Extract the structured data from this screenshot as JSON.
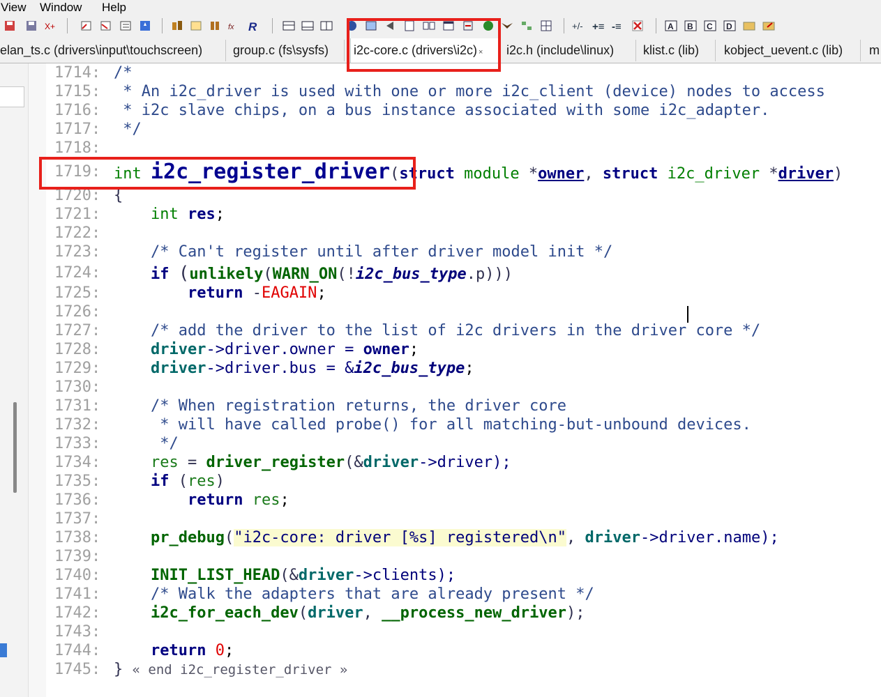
{
  "menu": [
    "View",
    "Window",
    "Help"
  ],
  "tabs": [
    {
      "label": "elan_ts.c (drivers\\input\\touchscreen)"
    },
    {
      "label": "group.c (fs\\sysfs)"
    },
    {
      "label": "i2c-core.c (drivers\\i2c)",
      "active": true,
      "close": "×"
    },
    {
      "label": "i2c.h (include\\linux)"
    },
    {
      "label": "klist.c (lib)"
    },
    {
      "label": "kobject_uevent.c (lib)"
    },
    {
      "label": "m"
    }
  ],
  "code": {
    "l1714": {
      "n": "1714:",
      "t": "/*"
    },
    "l1715": {
      "n": "1715:",
      "t": " * An i2c_driver is used with one or more i2c_client (device) nodes to access"
    },
    "l1716": {
      "n": "1716:",
      "t": " * i2c slave chips, on a bus instance associated with some i2c_adapter."
    },
    "l1717": {
      "n": "1717:",
      "t": " */"
    },
    "l1718": {
      "n": "1718:"
    },
    "l1719": {
      "n": "1719:",
      "int": "int",
      "name": "i2c_register_driver",
      "p1": "(",
      "struct1": "struct",
      "module": "module",
      "star1": "*",
      "owner": "owner",
      "comma": ",",
      "struct2": "struct",
      "i2cdrv": "i2c_driver",
      "star2": "*",
      "driver": "driver",
      "p2": ")"
    },
    "l1720": {
      "n": "1720:",
      "t": "{"
    },
    "l1721": {
      "n": "1721:",
      "int": "int",
      "res": "res",
      "semi": ";"
    },
    "l1722": {
      "n": "1722:"
    },
    "l1723": {
      "n": "1723:",
      "t": "/* Can't register until after driver model init */"
    },
    "l1724": {
      "n": "1724:",
      "if": "if",
      "a": "(",
      "unlikely": "unlikely",
      "b": "(",
      "warn": "WARN_ON",
      "c": "(!",
      "bus": "i2c_bus_type",
      "d": ".p)))"
    },
    "l1725": {
      "n": "1725:",
      "ret": "return",
      "minus": "-",
      "eagain": "EAGAIN",
      "semi": ";"
    },
    "l1726": {
      "n": "1726:"
    },
    "l1727": {
      "n": "1727:",
      "t": "/* add the driver to the list of i2c drivers in the driver core */"
    },
    "l1728": {
      "n": "1728:",
      "driver": "driver",
      "rest": "->driver.owner = ",
      "owner": "owner",
      "semi": ";"
    },
    "l1729": {
      "n": "1729:",
      "driver": "driver",
      "rest": "->driver.bus = &",
      "bus": "i2c_bus_type",
      "semi": ";"
    },
    "l1730": {
      "n": "1730:"
    },
    "l1731": {
      "n": "1731:",
      "t": "/* When registration returns, the driver core"
    },
    "l1732": {
      "n": "1732:",
      "t": " * will have called probe() for all matching-but-unbound devices."
    },
    "l1733": {
      "n": "1733:",
      "t": " */"
    },
    "l1734": {
      "n": "1734:",
      "res": "res",
      "eq": " = ",
      "fn": "driver_register",
      "a": "(&",
      "driver": "driver",
      "rest": "->driver);"
    },
    "l1735": {
      "n": "1735:",
      "if": "if",
      "a": " (",
      "res": "res",
      "b": ")"
    },
    "l1736": {
      "n": "1736:",
      "ret": "return",
      "res": "res",
      "semi": ";"
    },
    "l1737": {
      "n": "1737:"
    },
    "l1738": {
      "n": "1738:",
      "fn": "pr_debug",
      "a": "(",
      "str": "\"i2c-core: driver [%s] registered\\n\"",
      "b": ", ",
      "driver": "driver",
      "rest": "->driver.name);"
    },
    "l1739": {
      "n": "1739:"
    },
    "l1740": {
      "n": "1740:",
      "fn": "INIT_LIST_HEAD",
      "a": "(&",
      "driver": "driver",
      "rest": "->clients);"
    },
    "l1741": {
      "n": "1741:",
      "t": "/* Walk the adapters that are already present */"
    },
    "l1742": {
      "n": "1742:",
      "fn": "i2c_for_each_dev",
      "a": "(",
      "driver": "driver",
      "b": ", ",
      "cb": "__process_new_driver",
      "rest": ");"
    },
    "l1743": {
      "n": "1743:"
    },
    "l1744": {
      "n": "1744:",
      "ret": "return",
      "zero": "0",
      "semi": ";"
    },
    "l1745": {
      "n": "1745:",
      "brace": "}",
      "t": "« end i2c_register_driver »"
    }
  },
  "colors": {
    "highlight_box": "#e8201b",
    "comment": "#2e4a8c",
    "keyword": "#000080",
    "type": "#007f00",
    "string_bg": "#fbfbd0"
  }
}
